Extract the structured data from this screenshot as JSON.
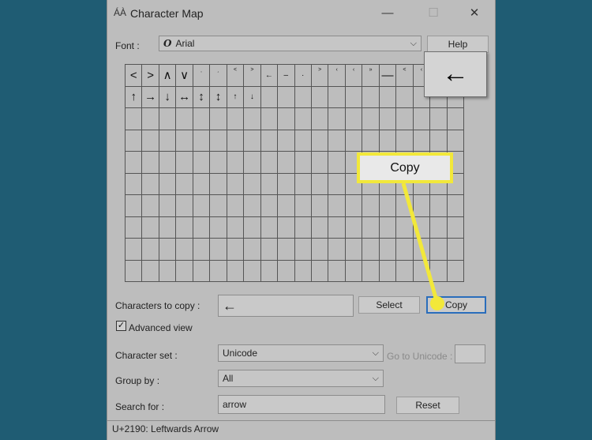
{
  "window": {
    "title": "Character Map",
    "minimize": "—",
    "maximize": "☐",
    "close": "✕"
  },
  "font": {
    "label": "Font :",
    "value": "Arial",
    "glyph": "O",
    "help_button": "Help"
  },
  "grid": {
    "rows": [
      [
        {
          "c": "<",
          "s": ""
        },
        {
          "c": ">",
          "s": ""
        },
        {
          "c": "∧",
          "s": ""
        },
        {
          "c": "∨",
          "s": ""
        },
        {
          "c": "˯",
          "s": "tiny"
        },
        {
          "c": "˰",
          "s": "tiny"
        },
        {
          "c": "˂",
          "s": "tiny"
        },
        {
          "c": "˃",
          "s": "tiny"
        },
        {
          "c": "←",
          "s": "small"
        },
        {
          "c": "–",
          "s": "small"
        },
        {
          "c": "·",
          "s": "small"
        },
        {
          "c": "˃",
          "s": "tiny"
        },
        {
          "c": "‹",
          "s": "tiny"
        },
        {
          "c": "‹",
          "s": "tiny"
        },
        {
          "c": "»",
          "s": "tiny"
        },
        {
          "c": "—",
          "s": ""
        },
        {
          "c": "˂",
          "s": "tiny"
        },
        {
          "c": "‹",
          "s": "tiny"
        },
        {
          "c": "",
          "s": ""
        },
        {
          "c": "",
          "s": ""
        }
      ],
      [
        {
          "c": "↑",
          "s": ""
        },
        {
          "c": "→",
          "s": ""
        },
        {
          "c": "↓",
          "s": ""
        },
        {
          "c": "↔",
          "s": ""
        },
        {
          "c": "↕",
          "s": ""
        },
        {
          "c": "↕",
          "s": ""
        },
        {
          "c": "↑",
          "s": "small"
        },
        {
          "c": "↓",
          "s": "small"
        },
        {
          "c": "",
          "s": ""
        },
        {
          "c": "",
          "s": ""
        },
        {
          "c": "",
          "s": ""
        },
        {
          "c": "",
          "s": ""
        },
        {
          "c": "",
          "s": ""
        },
        {
          "c": "",
          "s": ""
        },
        {
          "c": "",
          "s": ""
        },
        {
          "c": "",
          "s": ""
        },
        {
          "c": "",
          "s": ""
        },
        {
          "c": "",
          "s": ""
        },
        {
          "c": "",
          "s": ""
        },
        {
          "c": "",
          "s": ""
        }
      ]
    ],
    "total_rows": 10,
    "columns": 20
  },
  "zoom_char": "←",
  "copy_section": {
    "label": "Characters to copy :",
    "value": "←",
    "select_button": "Select",
    "copy_button": "Copy"
  },
  "advanced_view": {
    "label": "Advanced view",
    "checked": "✓"
  },
  "character_set": {
    "label": "Character set :",
    "value": "Unicode"
  },
  "goto_unicode": {
    "label": "Go to Unicode :",
    "value": ""
  },
  "group_by": {
    "label": "Group by :",
    "value": "All"
  },
  "search": {
    "label": "Search for :",
    "value": "arrow",
    "reset_button": "Reset"
  },
  "status_bar": "U+2190: Leftwards Arrow",
  "callout": {
    "label": "Copy",
    "color": "#f2e83a"
  },
  "colors": {
    "background": "#1f5c73",
    "window": "#bdbdbd",
    "focus": "#2a6dbb"
  }
}
